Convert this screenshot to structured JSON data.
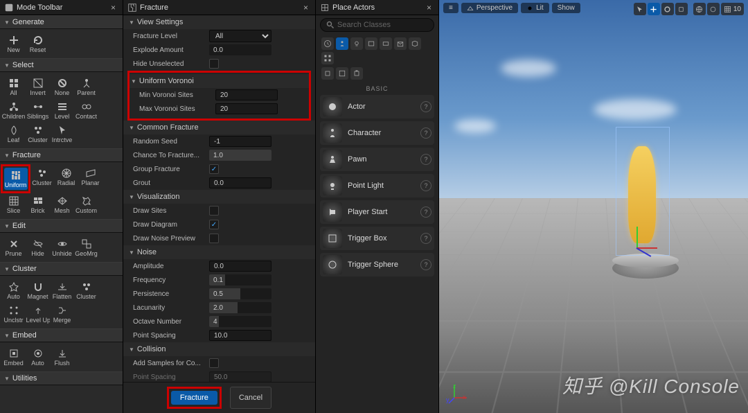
{
  "panels": {
    "modeToolbar": {
      "title": "Mode Toolbar"
    },
    "fracture": {
      "title": "Fracture"
    },
    "placeActors": {
      "title": "Place Actors"
    }
  },
  "left": {
    "generate": {
      "label": "Generate",
      "items": [
        "New",
        "Reset"
      ]
    },
    "select": {
      "label": "Select",
      "items": [
        "All",
        "Invert",
        "None",
        "Parent",
        "Children",
        "Siblings",
        "Level",
        "Contact",
        "Leaf",
        "Cluster",
        "Intrctve"
      ]
    },
    "fracture": {
      "label": "Fracture",
      "items": [
        "Uniform",
        "Cluster",
        "Radial",
        "Planar",
        "Slice",
        "Brick",
        "Mesh",
        "Custom"
      ]
    },
    "edit": {
      "label": "Edit",
      "items": [
        "Prune",
        "Hide",
        "Unhide",
        "GeoMrg"
      ]
    },
    "cluster": {
      "label": "Cluster",
      "items": [
        "Auto",
        "Magnet",
        "Flatten",
        "Cluster",
        "Unclstr",
        "Level Up",
        "Merge"
      ]
    },
    "embed": {
      "label": "Embed",
      "items": [
        "Embed",
        "Auto",
        "Flush"
      ]
    },
    "utilities": {
      "label": "Utilities"
    }
  },
  "settings": {
    "viewSettings": {
      "title": "View Settings",
      "fractureLevelLabel": "Fracture Level",
      "fractureLevelValue": "All",
      "explodeAmountLabel": "Explode Amount",
      "explodeAmountValue": "0.0",
      "hideUnselectedLabel": "Hide Unselected"
    },
    "uniformVoronoi": {
      "title": "Uniform Voronoi",
      "minLabel": "Min Voronoi Sites",
      "minValue": "20",
      "maxLabel": "Max Voronoi Sites",
      "maxValue": "20"
    },
    "commonFracture": {
      "title": "Common Fracture",
      "randomSeedLabel": "Random Seed",
      "randomSeedValue": "-1",
      "chanceLabel": "Chance To Fracture...",
      "chanceValue": "1.0",
      "groupFractureLabel": "Group Fracture",
      "groutLabel": "Grout",
      "groutValue": "0.0"
    },
    "visualization": {
      "title": "Visualization",
      "drawSitesLabel": "Draw Sites",
      "drawDiagramLabel": "Draw Diagram",
      "drawNoiseLabel": "Draw Noise Preview"
    },
    "noise": {
      "title": "Noise",
      "amplitudeLabel": "Amplitude",
      "amplitudeValue": "0.0",
      "frequencyLabel": "Frequency",
      "frequencyValue": "0.1",
      "persistenceLabel": "Persistence",
      "persistenceValue": "0.5",
      "lacunarityLabel": "Lacunarity",
      "lacunarityValue": "2.0",
      "octaveLabel": "Octave Number",
      "octaveValue": "4",
      "pointSpacingLabel": "Point Spacing",
      "pointSpacingValue": "10.0"
    },
    "collision": {
      "title": "Collision",
      "addSamplesLabel": "Add Samples for Co...",
      "pointSpacingLabel": "Point Spacing",
      "pointSpacingValue": "50.0"
    },
    "buttons": {
      "fracture": "Fracture",
      "cancel": "Cancel"
    }
  },
  "placeActors": {
    "searchPlaceholder": "Search Classes",
    "basicLabel": "BASIC",
    "items": [
      "Actor",
      "Character",
      "Pawn",
      "Point Light",
      "Player Start",
      "Trigger Box",
      "Trigger Sphere"
    ]
  },
  "viewport": {
    "perspective": "Perspective",
    "lit": "Lit",
    "show": "Show",
    "gridValue": "10",
    "watermark": "知乎 @Kill Console"
  }
}
